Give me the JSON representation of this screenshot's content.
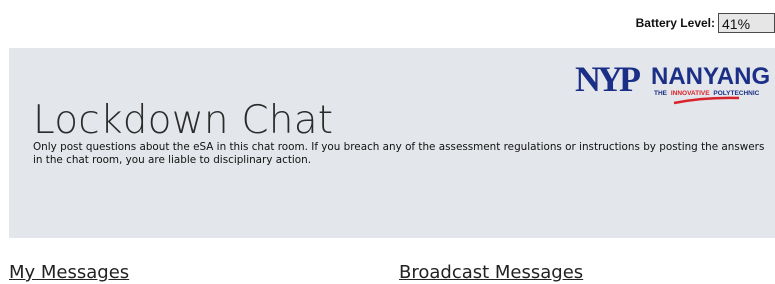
{
  "battery": {
    "label": "Battery Level:",
    "value": "41%"
  },
  "logo": {
    "mark": "NYP",
    "name": "NANYANG",
    "tagline_prefix": "THE",
    "tagline_highlight": "INNOVATIVE",
    "tagline_suffix": "POLYTECHNIC"
  },
  "header": {
    "title": "Lockdown Chat",
    "notice": "Only post questions about the eSA in this chat room. If you breach any of the assessment regulations or instructions by posting the answers in the chat room, you are liable to disciplinary action."
  },
  "sections": {
    "my_messages": "My Messages",
    "broadcast_messages": "Broadcast Messages"
  },
  "colors": {
    "jumbotron_bg": "#e3e6ea",
    "logo_navy": "#1b2f86",
    "logo_red": "#d8232a"
  }
}
